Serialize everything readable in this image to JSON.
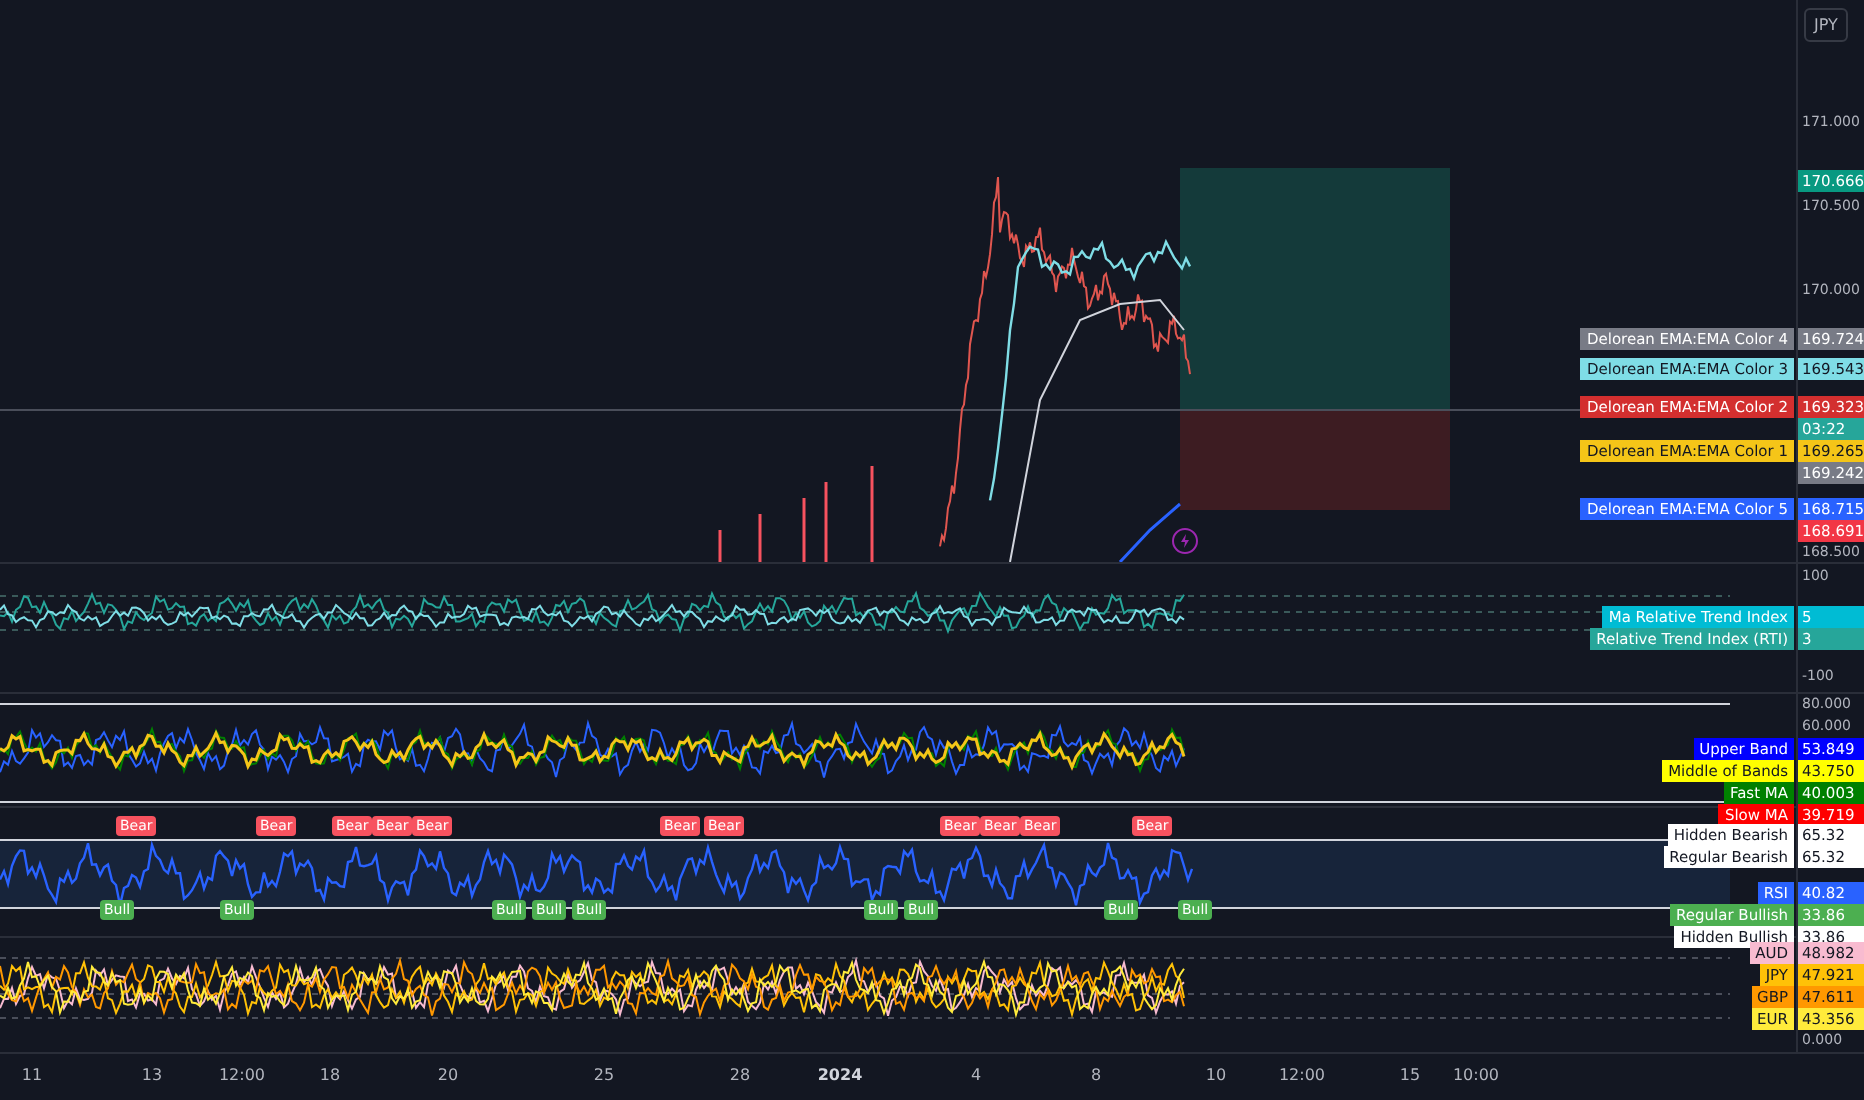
{
  "currency_button": "JPY",
  "price_pane": {
    "axis_labels": [
      "171.000",
      "170.500",
      "170.000",
      "168.500"
    ],
    "tags": [
      {
        "kind": "price",
        "value": "170.666",
        "color": "#089981"
      },
      {
        "kind": "price",
        "label": "Delorean EMA:EMA Color 4",
        "value": "169.724",
        "color": "#787b86"
      },
      {
        "kind": "price",
        "label": "Delorean EMA:EMA Color 3",
        "value": "169.543",
        "color": "#7fdde6"
      },
      {
        "kind": "price",
        "label": "Delorean EMA:EMA Color 2",
        "value": "169.323",
        "color": "#d32f2f"
      },
      {
        "kind": "countdown",
        "value": "03:22",
        "color": "#26a69a"
      },
      {
        "kind": "price",
        "label": "Delorean EMA:EMA Color 1",
        "value": "169.265",
        "color": "#f5c518"
      },
      {
        "kind": "price",
        "value": "169.242",
        "color": "#787b86"
      },
      {
        "kind": "price",
        "label": "Delorean EMA:EMA Color 5",
        "value": "168.715",
        "color": "#2962ff"
      },
      {
        "kind": "price",
        "value": "168.691",
        "color": "#f23645"
      }
    ]
  },
  "indicator_panes": [
    {
      "kind": "rti",
      "axis_labels": [
        "100",
        "-100"
      ],
      "tags": [
        {
          "label": "Ma Relative Trend Index",
          "value": "5",
          "color": "#00bcd4"
        },
        {
          "label": "Relative Trend Index (RTI)",
          "value": "3",
          "color": "#26a69a"
        }
      ]
    },
    {
      "kind": "bands",
      "axis_labels": [
        "80.000",
        "60.000"
      ],
      "tags": [
        {
          "label": "Upper Band",
          "value": "53.849",
          "color": "#0000ff"
        },
        {
          "label": "Middle of Bands",
          "value": "43.750",
          "color": "#ffff00"
        },
        {
          "label": "Fast MA",
          "value": "40.003",
          "color": "#008000"
        },
        {
          "label": "Slow MA",
          "value": "39.719",
          "color": "#ff0000"
        }
      ]
    },
    {
      "kind": "rsi",
      "tags": [
        {
          "label": "Hidden Bearish",
          "value": "65.32",
          "color": "#ffffff"
        },
        {
          "label": "Regular Bearish",
          "value": "65.32",
          "color": "#ffffff"
        },
        {
          "label": "RSI",
          "value": "40.82",
          "color": "#2962ff"
        },
        {
          "label": "Regular Bullish",
          "value": "33.86",
          "color": "#4caf50"
        },
        {
          "label": "Hidden Bullish",
          "value": "33.86",
          "color": "#ffffff"
        }
      ],
      "signals": [
        {
          "kind": "bear",
          "text": "Bear"
        },
        {
          "kind": "bear",
          "text": "Bear"
        },
        {
          "kind": "bear",
          "text": "Bear"
        },
        {
          "kind": "bear",
          "text": "Bear"
        },
        {
          "kind": "bear",
          "text": "Bear"
        },
        {
          "kind": "bear",
          "text": "Bear"
        },
        {
          "kind": "bear",
          "text": "Bear"
        },
        {
          "kind": "bear",
          "text": "Bear"
        },
        {
          "kind": "bear",
          "text": "Bear"
        },
        {
          "kind": "bear",
          "text": "Bear"
        },
        {
          "kind": "bear",
          "text": "Bear"
        },
        {
          "kind": "bull",
          "text": "Bull"
        },
        {
          "kind": "bull",
          "text": "Bull"
        },
        {
          "kind": "bull",
          "text": "Bull"
        },
        {
          "kind": "bull",
          "text": "Bull"
        },
        {
          "kind": "bull",
          "text": "Bull"
        },
        {
          "kind": "bull",
          "text": "Bull"
        },
        {
          "kind": "bull",
          "text": "Bull"
        },
        {
          "kind": "bull",
          "text": "Bull"
        },
        {
          "kind": "bull",
          "text": "Bull"
        }
      ]
    },
    {
      "kind": "currencies",
      "axis_labels": [
        "0.000"
      ],
      "tags": [
        {
          "label": "AUD",
          "value": "48.982",
          "color": "#f8bbd0"
        },
        {
          "label": "JPY",
          "value": "47.921",
          "color": "#ffc107"
        },
        {
          "label": "GBP",
          "value": "47.611",
          "color": "#ff9800"
        },
        {
          "label": "EUR",
          "value": "43.356",
          "color": "#ffeb3b"
        }
      ]
    }
  ],
  "time_axis": [
    {
      "text": "11",
      "major": false
    },
    {
      "text": "13",
      "major": false
    },
    {
      "text": "12:00",
      "major": false
    },
    {
      "text": "18",
      "major": false
    },
    {
      "text": "20",
      "major": false
    },
    {
      "text": "25",
      "major": false
    },
    {
      "text": "28",
      "major": false
    },
    {
      "text": "2024",
      "major": true
    },
    {
      "text": "4",
      "major": false
    },
    {
      "text": "8",
      "major": false
    },
    {
      "text": "10",
      "major": false
    },
    {
      "text": "12:00",
      "major": false
    },
    {
      "text": "15",
      "major": false
    },
    {
      "text": "10:00",
      "major": false
    }
  ]
}
